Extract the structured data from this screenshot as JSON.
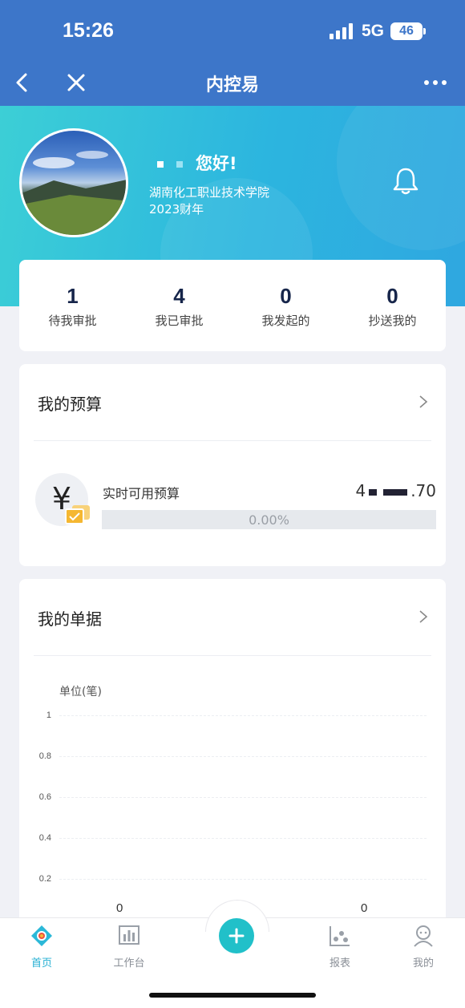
{
  "status_bar": {
    "time": "15:26",
    "network": "5G",
    "battery": "46"
  },
  "nav": {
    "title": "内控易"
  },
  "profile": {
    "greeting": "您好!",
    "organization": "湖南化工职业技术学院",
    "fiscal_year": "2023财年"
  },
  "stats": [
    {
      "value": "1",
      "label": "待我审批"
    },
    {
      "value": "4",
      "label": "我已审批"
    },
    {
      "value": "0",
      "label": "我发起的"
    },
    {
      "value": "0",
      "label": "抄送我的"
    }
  ],
  "budget": {
    "title": "我的预算",
    "icon_symbol": "¥",
    "label": "实时可用预算",
    "value_prefix": "4",
    "value_suffix": ".70",
    "progress_percent": 0,
    "progress_text": "0.00%"
  },
  "documents": {
    "title": "我的单据",
    "unit_label": "单位(笔)",
    "y_ticks": [
      "1",
      "0.8",
      "0.6",
      "0.4",
      "0.2"
    ],
    "data_labels": [
      "0",
      "0"
    ]
  },
  "tabs": [
    {
      "label": "首页",
      "icon": "home-icon",
      "active": true
    },
    {
      "label": "工作台",
      "icon": "workbench-chart-icon",
      "active": false
    },
    {
      "label": "报表",
      "icon": "report-icon",
      "active": false
    },
    {
      "label": "我的",
      "icon": "profile-icon",
      "active": false
    }
  ],
  "colors": {
    "primary": "#3d76c9",
    "accent": "#21c0c9",
    "active_tab": "#26b0d3"
  }
}
